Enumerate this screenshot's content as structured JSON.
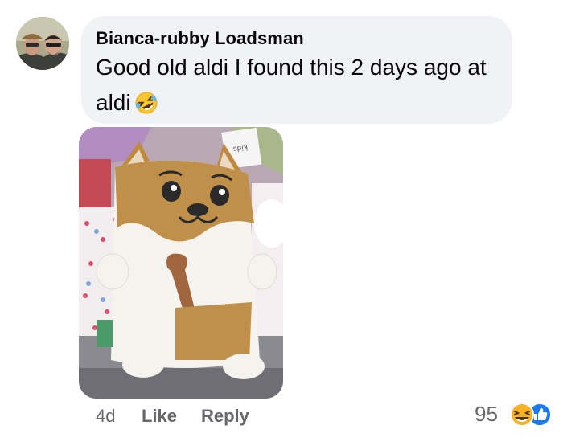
{
  "comment": {
    "author": "Bianca-rubby Loadsman",
    "text": "Good old aldi I found this 2 days ago at aldi",
    "emoji": "rolling-on-floor-laughing-icon"
  },
  "photo": {
    "tag_text": "kids"
  },
  "actions": {
    "time": "4d",
    "like_label": "Like",
    "reply_label": "Reply"
  },
  "reactions": {
    "count": "95",
    "types": [
      "laughing-face-icon",
      "like-thumb-icon"
    ],
    "like_color": "#1877f2",
    "haha_color": "#f7b125"
  },
  "colors": {
    "bubble": "#f0f2f5",
    "text": "#050505",
    "secondary": "#65676b"
  }
}
